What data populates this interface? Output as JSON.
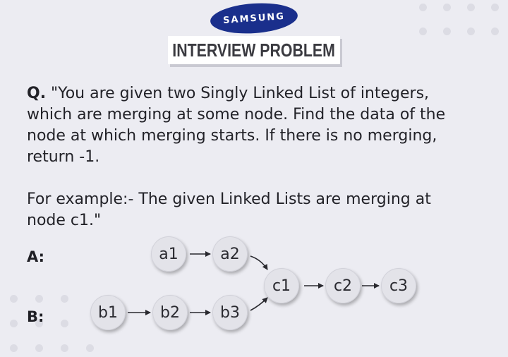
{
  "header": {
    "brand": "SAMSUNG",
    "title": "INTERVIEW PROBLEM"
  },
  "question": {
    "prefix": "Q.",
    "line1": " \"You are given two Singly Linked List of integers,",
    "line2": "which are merging at some node. Find the data of the",
    "line3": "node at which merging starts. If there is no merging,",
    "line4": "return -1.",
    "example1": "For example:- The given Linked Lists are merging at",
    "example2": "node c1.\""
  },
  "diagram": {
    "label_a": "A:",
    "label_b": "B:",
    "nodes": {
      "a1": "a1",
      "a2": "a2",
      "b1": "b1",
      "b2": "b2",
      "b3": "b3",
      "c1": "c1",
      "c2": "c2",
      "c3": "c3"
    }
  },
  "colors": {
    "background": "#ececf2",
    "brand": "#1a2f8c",
    "node": "#e3e3e9"
  }
}
